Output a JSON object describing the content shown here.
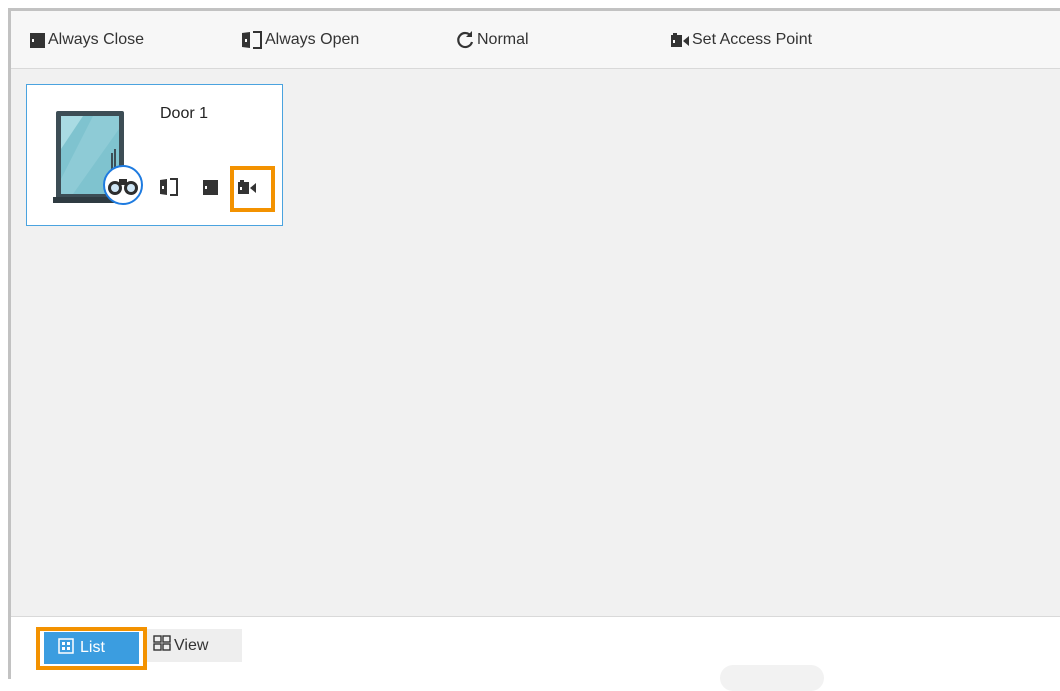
{
  "toolbar": {
    "always_close": "Always Close",
    "always_open": "Always Open",
    "normal": "Normal",
    "set_access_point": "Set Access Point"
  },
  "door_card": {
    "name": "Door 1",
    "icons": [
      "always-open-icon",
      "always-close-icon",
      "camera-icon"
    ]
  },
  "view_switch": {
    "list_label": "List",
    "view_label": "View",
    "selected": "List"
  },
  "colors": {
    "accent_blue": "#3b9de0",
    "highlight_orange": "#f39200",
    "card_border": "#4aa3df"
  }
}
